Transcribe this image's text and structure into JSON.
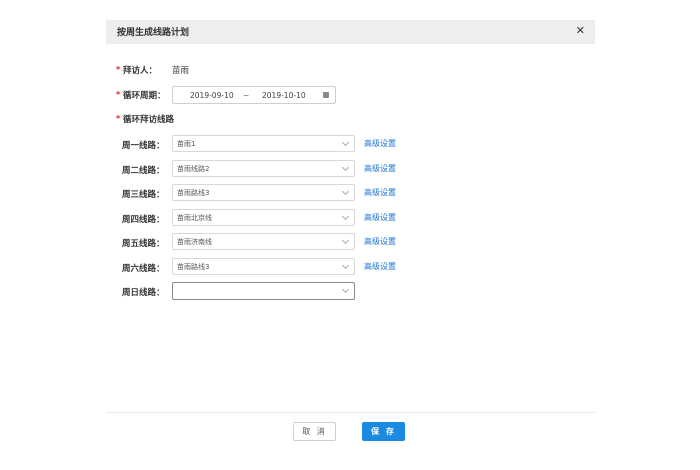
{
  "dialog": {
    "title": "按周生成线路计划",
    "close_symbol": "✕"
  },
  "visitor": {
    "label": "拜访人：",
    "value": "苗雨"
  },
  "cycle": {
    "label": "循环周期：",
    "start_date": "2019-09-10",
    "separator": "~",
    "end_date": "2019-10-10"
  },
  "routes_section": {
    "label": "循环拜访线路"
  },
  "advanced_link_label": "高级设置",
  "days": [
    {
      "label": "周一线路：",
      "value": "苗雨1"
    },
    {
      "label": "周二线路：",
      "value": "苗雨线路2"
    },
    {
      "label": "周三线路：",
      "value": "苗雨路线3"
    },
    {
      "label": "周四线路：",
      "value": "苗雨北京线"
    },
    {
      "label": "周五线路：",
      "value": "苗雨济南线"
    },
    {
      "label": "周六线路：",
      "value": "苗雨路线3"
    },
    {
      "label": "周日线路：",
      "value": ""
    }
  ],
  "footer": {
    "cancel_label": "取 消",
    "save_label": "保 存"
  },
  "colors": {
    "accent": "#1a8be0",
    "link": "#1a73d4",
    "required": "#e02020",
    "header_bg": "#eeeeee"
  }
}
